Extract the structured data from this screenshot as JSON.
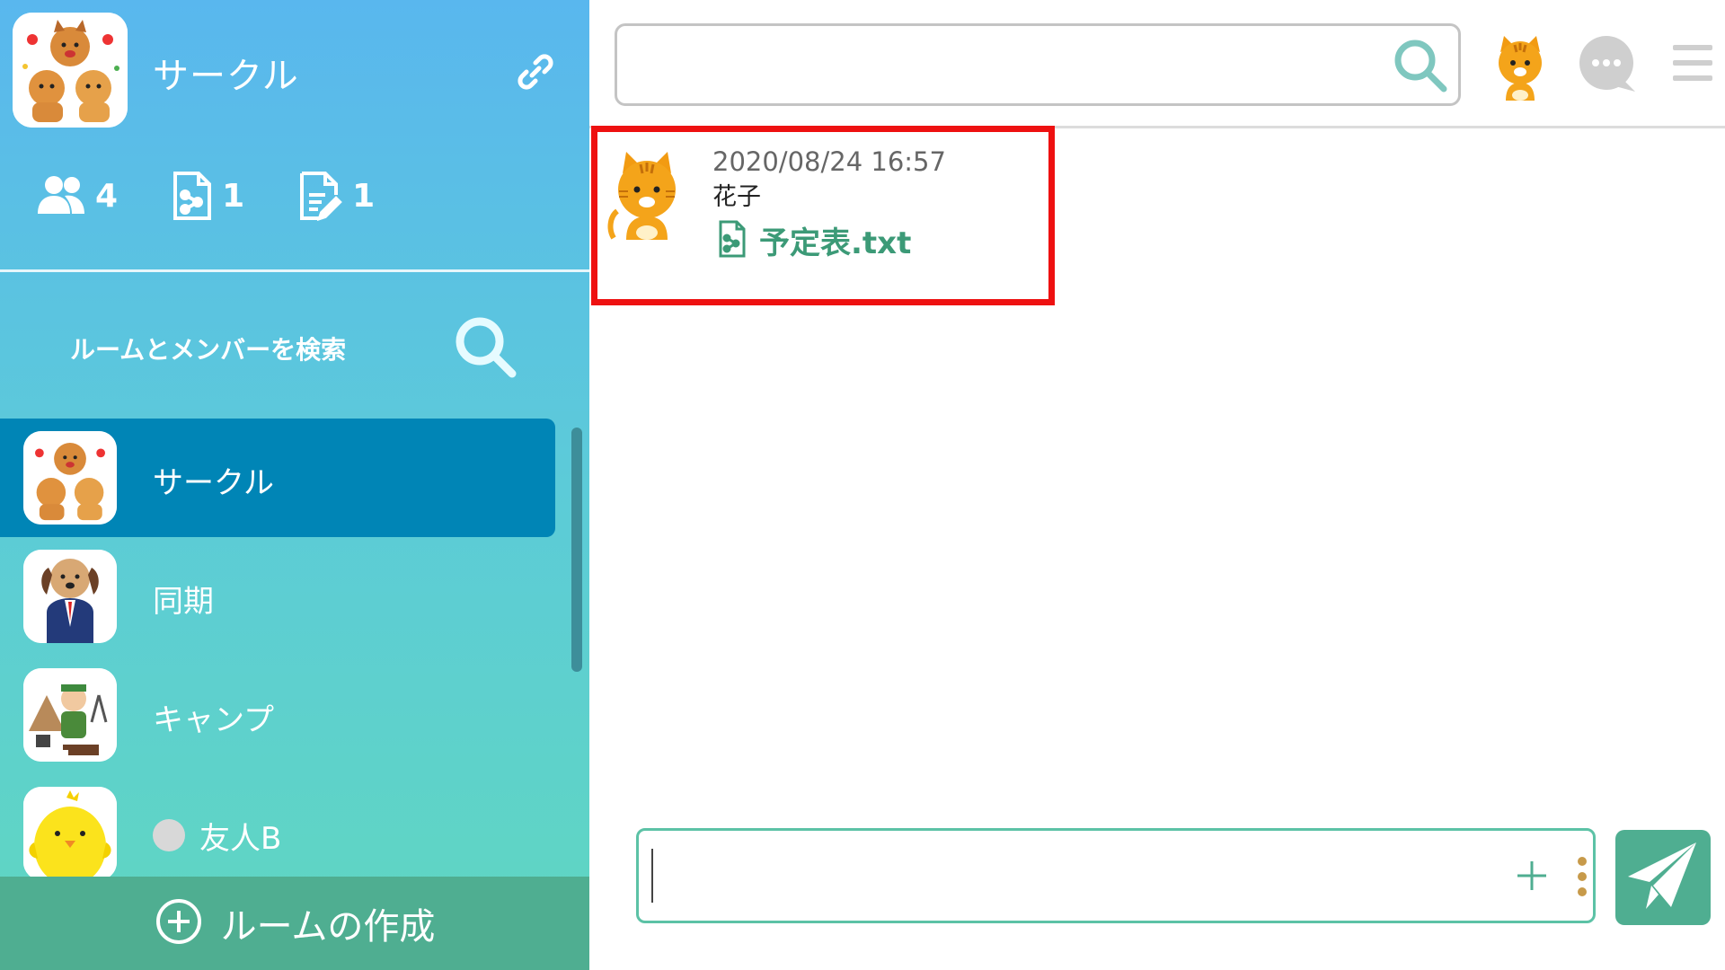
{
  "sidebar": {
    "circle_title": "サークル",
    "stats": [
      {
        "icon": "members-icon",
        "count": "4"
      },
      {
        "icon": "shared-file-icon",
        "count": "1"
      },
      {
        "icon": "note-icon",
        "count": "1"
      }
    ],
    "search_label": "ルームとメンバーを検索",
    "rooms": [
      {
        "label": "サークル",
        "avatar": "dogs-celebrating-avatar",
        "active": true
      },
      {
        "label": "同期",
        "avatar": "dog-businessman-avatar",
        "active": false
      },
      {
        "label": "キャンプ",
        "avatar": "camper-avatar",
        "active": false
      },
      {
        "label": "友人B",
        "avatar": "chick-avatar",
        "active": false,
        "status": "offline"
      }
    ],
    "create_room_label": "ルームの作成"
  },
  "main": {
    "search_placeholder": "",
    "message": {
      "time": "2020/08/24 16:57",
      "sender": "花子",
      "file_name": "予定表.txt",
      "avatar": "orange-cat-avatar"
    },
    "composer_placeholder": ""
  },
  "colors": {
    "sidebar_top": "#59b7ee",
    "sidebar_bottom": "#60d7c0",
    "active_room": "#0085b6",
    "accent_green": "#4fae91",
    "file_green": "#3c9a77",
    "highlight_red": "#ee1111"
  }
}
